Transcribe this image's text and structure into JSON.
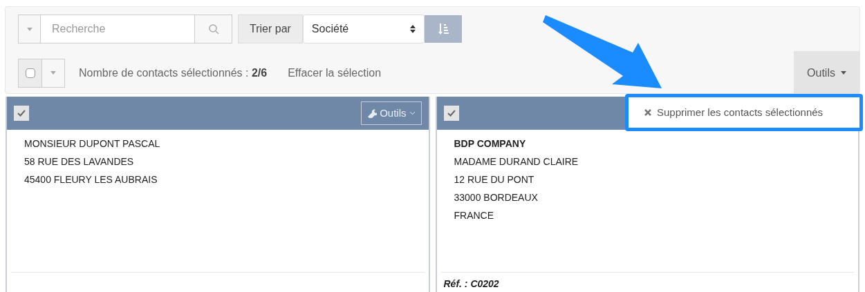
{
  "toolbar": {
    "search": {
      "placeholder": "Recherche"
    },
    "sort_label": "Trier par",
    "sort_value": "Société",
    "select_all": {
      "checked": false
    },
    "selection_count": "Nombre de contacts sélectionnés : **2/6**",
    "clear_selection": "Effacer la sélection",
    "tools_button": {
      "label": "Outils",
      "expanded": true
    }
  },
  "tools_menu": [
    {
      "label": "Supprimer les contacts sélectionnés"
    }
  ],
  "cards": [
    {
      "checked": true,
      "tools_label": "Outils",
      "lines": [
        {
          "text": "MONSIEUR DUPONT PASCAL",
          "bold": false
        },
        {
          "text": "58 RUE DES LAVANDES",
          "bold": false
        },
        {
          "text": "45400 FLEURY LES AUBRAIS",
          "bold": false
        }
      ]
    },
    {
      "checked": true,
      "lines": [
        {
          "text": "BDP COMPANY",
          "bold": true
        },
        {
          "text": "MADAME DURAND CLAIRE",
          "bold": false
        },
        {
          "text": "12 RUE DU PONT",
          "bold": false
        },
        {
          "text": "33000 BORDEAUX",
          "bold": false
        },
        {
          "text": "FRANCE",
          "bold": false
        }
      ],
      "ref": "Réf. : C0202"
    }
  ]
}
